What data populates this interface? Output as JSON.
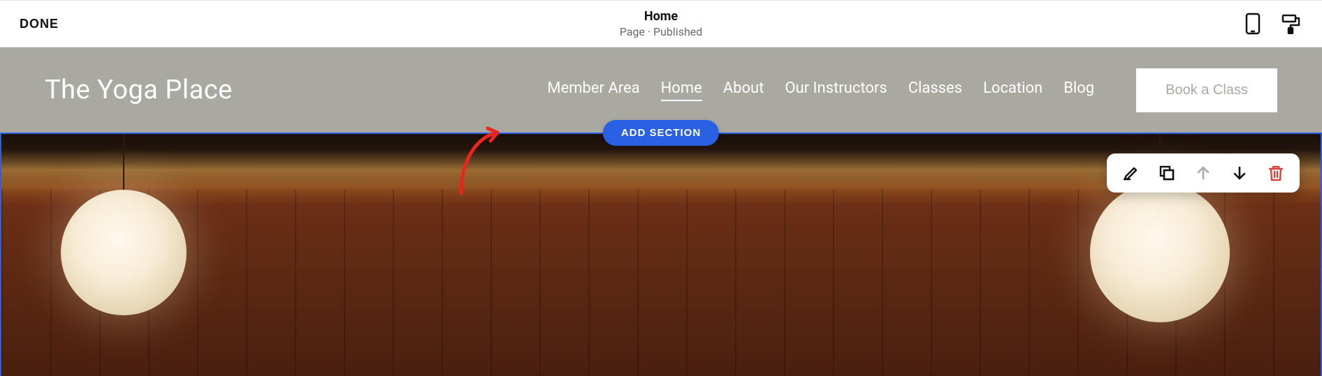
{
  "topbar": {
    "done_label": "DONE",
    "title": "Home",
    "subtitle": "Page · Published",
    "icons": {
      "mobile": "mobile-icon",
      "paint": "paint-roller-icon"
    }
  },
  "site": {
    "title": "The Yoga Place",
    "nav": [
      {
        "label": "Member Area",
        "active": false
      },
      {
        "label": "Home",
        "active": true
      },
      {
        "label": "About",
        "active": false
      },
      {
        "label": "Our Instructors",
        "active": false
      },
      {
        "label": "Classes",
        "active": false
      },
      {
        "label": "Location",
        "active": false
      },
      {
        "label": "Blog",
        "active": false
      }
    ],
    "cta_label": "Book a Class"
  },
  "editor": {
    "add_section_label": "ADD SECTION",
    "section_toolbar": {
      "edit": "pencil-icon",
      "duplicate": "duplicate-icon",
      "move_up": "arrow-up-icon",
      "move_down": "arrow-down-icon",
      "delete": "trash-icon",
      "move_up_disabled": true
    },
    "colors": {
      "selection": "#2a60e4",
      "delete": "#d9443a"
    }
  }
}
